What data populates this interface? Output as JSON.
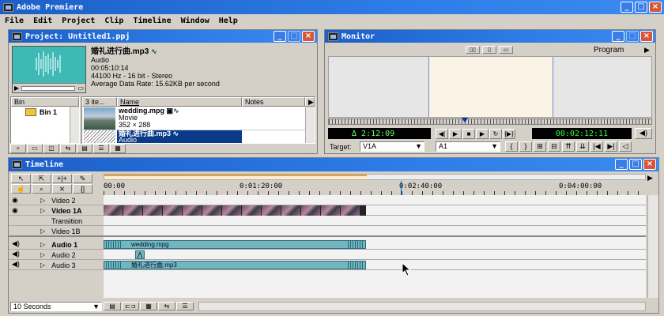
{
  "app": {
    "title": "Adobe Premiere"
  },
  "menu": [
    "File",
    "Edit",
    "Project",
    "Clip",
    "Timeline",
    "Window",
    "Help"
  ],
  "project": {
    "title": "Project: Untitled1.ppj",
    "preview": {
      "name": "婚礼进行曲.mp3",
      "type": "Audio",
      "duration": "00:05:10:14",
      "format": "44100 Hz - 16 bit - Stereo",
      "rate": "Average Data Rate: 15.62KB per second"
    },
    "bin_header": "Bin",
    "bin_name": "Bin 1",
    "items_header": "3 ite...",
    "name_header": "Name",
    "notes_header": "Notes",
    "items": [
      {
        "name": "wedding.mpg",
        "type": "Movie",
        "info": "352 × 288"
      },
      {
        "name": "婚礼进行曲.mp3",
        "type": "Audio",
        "info": ""
      }
    ]
  },
  "monitor": {
    "title": "Monitor",
    "program_label": "Program",
    "timecode_left": "Δ 2:12:09",
    "timecode_right": "00:02:12:11",
    "target_label": "Target:",
    "target_video": "V1A",
    "target_audio": "A1"
  },
  "timeline": {
    "title": "Timeline",
    "ruler": [
      "00:00",
      "0:01:20:00",
      "0:02:40:00",
      "0:04:00:00"
    ],
    "tracks": [
      {
        "name": "Video 2",
        "bold": false
      },
      {
        "name": "Video 1A",
        "bold": true
      },
      {
        "name": "Transition",
        "bold": false
      },
      {
        "name": "Video 1B",
        "bold": false
      },
      {
        "name": "Audio 1",
        "bold": true
      },
      {
        "name": "Audio 2",
        "bold": false
      },
      {
        "name": "Audio 3",
        "bold": false
      }
    ],
    "clip_video": "wedding.mpg",
    "clip_audio": "婚礼进行曲.mp3",
    "zoom": "10 Seconds"
  },
  "colors": {
    "titlebar": "#2e7ce6",
    "clip": "#74b6c0",
    "timecode": "#33ff33",
    "selection": "#0a3a8a"
  }
}
